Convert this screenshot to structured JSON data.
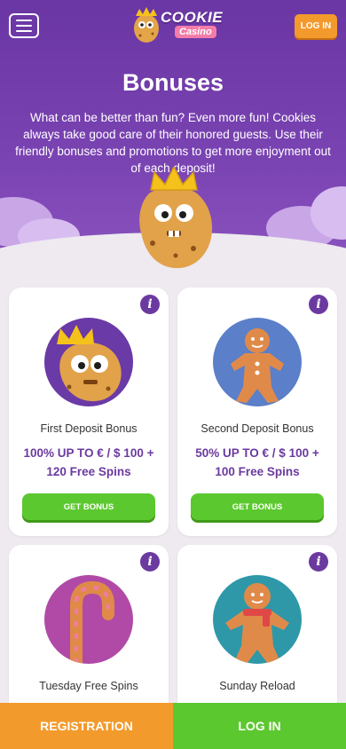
{
  "header": {
    "logo_main": "COOKIE",
    "logo_sub": "Casino",
    "login_label": "LOG IN"
  },
  "hero": {
    "title": "Bonuses",
    "intro": "What can be better than fun? Even more fun! Cookies always take good care of their honored guests. Use their friendly bonuses and promotions to get more enjoyment out of each deposit!"
  },
  "bonuses": [
    {
      "name": "First Deposit Bonus",
      "offer": "100% UP TO € / $ 100 + 120 Free Spins",
      "cta": "GET BONUS",
      "art": "cookie-king-icon",
      "bg": "#6a3aa6"
    },
    {
      "name": "Second Deposit Bonus",
      "offer": "50% UP TO € / $ 100 + 100 Free Spins",
      "cta": "GET BONUS",
      "art": "gingerbread-man-icon",
      "bg": "#5b7fc9"
    },
    {
      "name": "Tuesday Free Spins",
      "art": "candy-cane-icon",
      "bg": "#b04aa6"
    },
    {
      "name": "Sunday Reload",
      "art": "gingerbread-scarf-icon",
      "bg": "#2e98a8"
    }
  ],
  "bottom_bar": {
    "registration": "REGISTRATION",
    "login": "LOG IN"
  },
  "colors": {
    "purple": "#6b3aa0",
    "orange": "#f39a2c",
    "green": "#5cc82f"
  }
}
